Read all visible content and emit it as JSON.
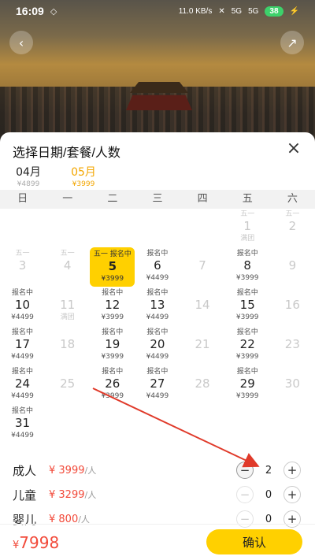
{
  "status": {
    "time": "16:09",
    "net_speed": "11.0 KB/s",
    "signal1": "5G",
    "signal2": "5G",
    "battery": "38"
  },
  "header": {
    "back_icon": "chevron-left-icon",
    "share_icon": "share-icon"
  },
  "sheet": {
    "title": "选择日期/套餐/人数",
    "close_icon": "close-icon",
    "months": [
      {
        "label": "04月",
        "price": "¥4899"
      },
      {
        "label": "05月",
        "price": "¥3999"
      }
    ],
    "weekdays": [
      "日",
      "一",
      "二",
      "三",
      "四",
      "五",
      "六"
    ],
    "days": [
      {
        "top": "五一",
        "day": "1",
        "price": "满团",
        "state": "dim"
      },
      {
        "top": "五一",
        "day": "2",
        "price": "",
        "state": "dim"
      },
      {
        "top": "五一",
        "day": "3",
        "price": "",
        "state": "dim"
      },
      {
        "top": "五一",
        "day": "4",
        "price": "",
        "state": "dim"
      },
      {
        "top": "五一  报名中",
        "day": "5",
        "price": "¥3999",
        "state": "sel"
      },
      {
        "top": "报名中",
        "day": "6",
        "price": "¥4499",
        "state": ""
      },
      {
        "top": "",
        "day": "7",
        "price": "",
        "state": "dim"
      },
      {
        "top": "报名中",
        "day": "8",
        "price": "¥3999",
        "state": ""
      },
      {
        "top": "",
        "day": "9",
        "price": "",
        "state": "dim"
      },
      {
        "top": "报名中",
        "day": "10",
        "price": "¥4499",
        "state": ""
      },
      {
        "top": "",
        "day": "11",
        "price": "满团",
        "state": "dim"
      },
      {
        "top": "报名中",
        "day": "12",
        "price": "¥3999",
        "state": ""
      },
      {
        "top": "报名中",
        "day": "13",
        "price": "¥4499",
        "state": ""
      },
      {
        "top": "",
        "day": "14",
        "price": "",
        "state": "dim"
      },
      {
        "top": "报名中",
        "day": "15",
        "price": "¥3999",
        "state": ""
      },
      {
        "top": "",
        "day": "16",
        "price": "",
        "state": "dim"
      },
      {
        "top": "报名中",
        "day": "17",
        "price": "¥4499",
        "state": ""
      },
      {
        "top": "",
        "day": "18",
        "price": "",
        "state": "dim"
      },
      {
        "top": "报名中",
        "day": "19",
        "price": "¥3999",
        "state": ""
      },
      {
        "top": "报名中",
        "day": "20",
        "price": "¥4499",
        "state": ""
      },
      {
        "top": "",
        "day": "21",
        "price": "",
        "state": "dim"
      },
      {
        "top": "报名中",
        "day": "22",
        "price": "¥3999",
        "state": ""
      },
      {
        "top": "",
        "day": "23",
        "price": "",
        "state": "dim"
      },
      {
        "top": "报名中",
        "day": "24",
        "price": "¥4499",
        "state": ""
      },
      {
        "top": "",
        "day": "25",
        "price": "",
        "state": "dim"
      },
      {
        "top": "报名中",
        "day": "26",
        "price": "¥3999",
        "state": ""
      },
      {
        "top": "报名中",
        "day": "27",
        "price": "¥4499",
        "state": ""
      },
      {
        "top": "",
        "day": "28",
        "price": "",
        "state": "dim"
      },
      {
        "top": "报名中",
        "day": "29",
        "price": "¥3999",
        "state": ""
      },
      {
        "top": "",
        "day": "30",
        "price": "",
        "state": "dim"
      },
      {
        "top": "报名中",
        "day": "31",
        "price": "¥4499",
        "state": ""
      }
    ],
    "travelers": [
      {
        "label": "成人",
        "price": "¥ 3999",
        "unit": "/人",
        "qty": "2"
      },
      {
        "label": "儿童",
        "price": "¥ 3299",
        "unit": "/人",
        "qty": "0"
      },
      {
        "label": "婴儿",
        "price": "¥ 800",
        "unit": "/人",
        "qty": "0"
      }
    ],
    "total": "7998",
    "total_currency": "¥",
    "confirm": "确认",
    "accent": "#ffd000",
    "price_color": "#f24a3a"
  }
}
